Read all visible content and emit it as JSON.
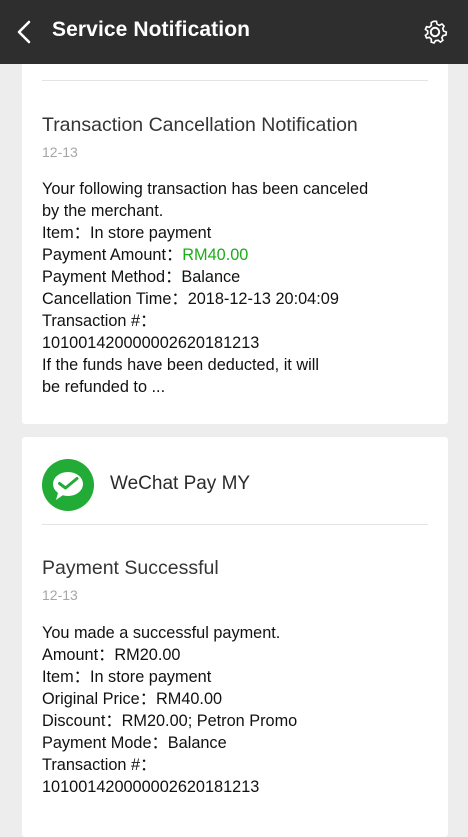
{
  "header": {
    "title": "Service Notification"
  },
  "notifications": [
    {
      "title": "Transaction Cancellation Notification",
      "date": "12-13",
      "lines": [
        "Your following transaction has been canceled",
        "by the merchant.",
        "Item：In store payment",
        "Payment Method：Balance",
        "Cancellation Time：2018-12-13 20:04:09",
        "Transaction #：",
        "101001420000002620181213",
        "If the funds have been deducted, it will",
        "be refunded to ..."
      ],
      "amount_label": "Payment Amount：",
      "amount_value": "RM40.00"
    },
    {
      "sender": "WeChat Pay MY",
      "title": "Payment Successful",
      "date": "12-13",
      "lines": [
        "You made a successful payment.",
        "Amount：RM20.00",
        "Item：In store payment",
        "Original Price：RM40.00",
        "Discount：RM20.00; Petron Promo",
        "Payment Mode：Balance",
        "Transaction #：",
        "101001420000002620181213"
      ]
    }
  ],
  "colors": {
    "header_bg": "#2e2e2e",
    "accent_green": "#1aad19",
    "logo_green": "#23ab38",
    "page_bg": "#ededed"
  },
  "icons": {
    "back": "chevron-left-icon",
    "settings": "gear-icon",
    "logo": "wechat-pay-logo-icon"
  }
}
